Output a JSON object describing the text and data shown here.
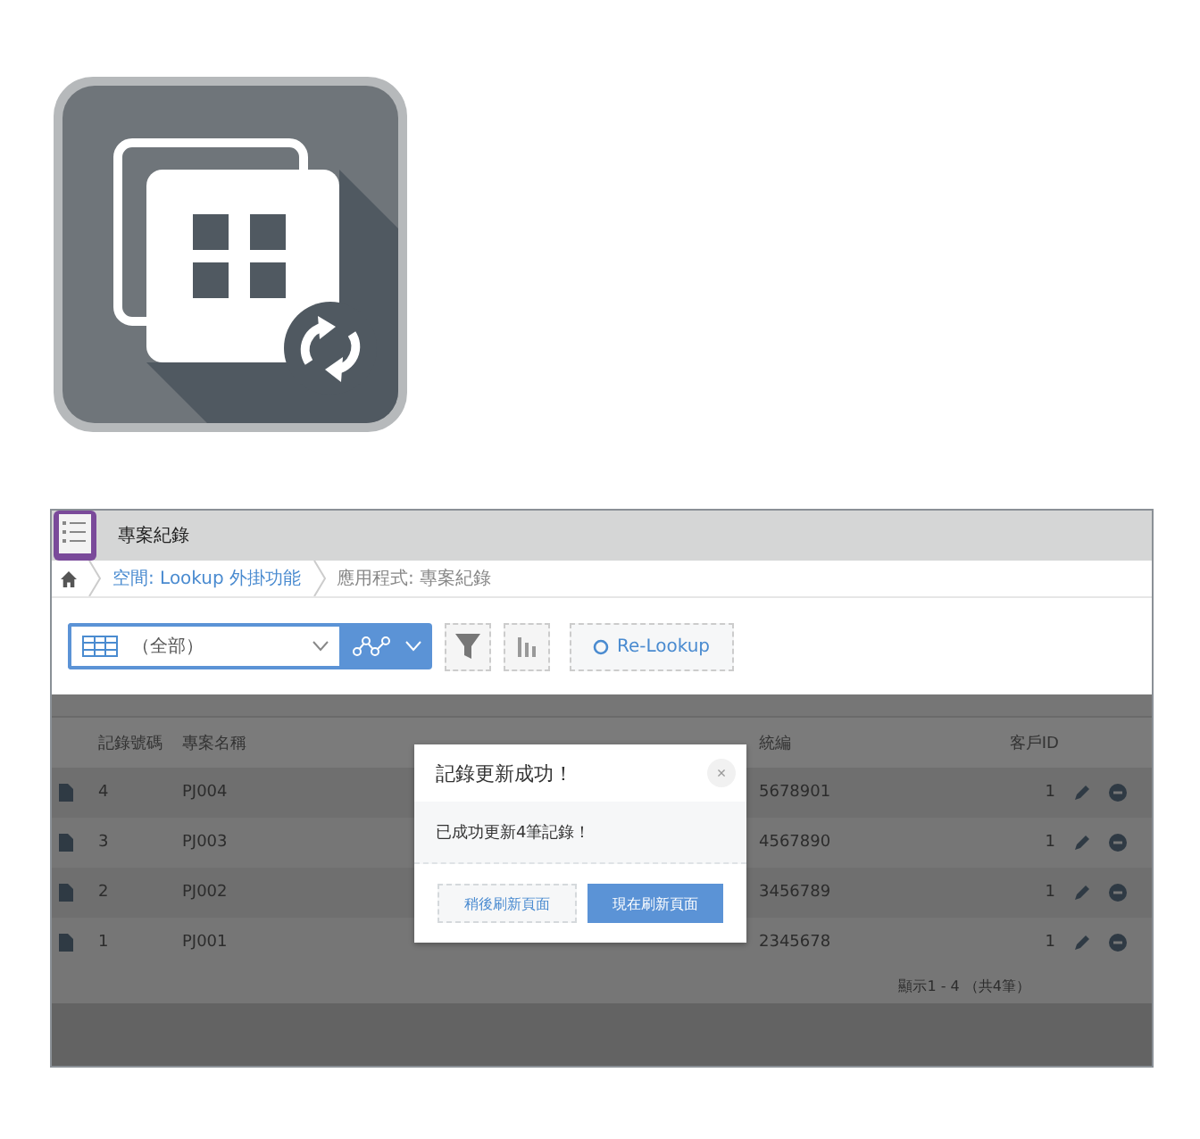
{
  "app": {
    "title": "專案紀錄"
  },
  "breadcrumbs": [
    {
      "label": "空間: Lookup 外掛功能",
      "link": true
    },
    {
      "label": "應用程式: 專案紀錄",
      "link": false
    }
  ],
  "toolbar": {
    "view": "（全部）",
    "relookup": "Re-Lookup"
  },
  "table": {
    "columns": [
      "記錄號碼",
      "專案名稱",
      "統編",
      "客戶ID"
    ],
    "rows": [
      {
        "number": "4",
        "name": "PJ004",
        "tax_id": "5678901",
        "customer_id": "1"
      },
      {
        "number": "3",
        "name": "PJ003",
        "tax_id": "4567890",
        "customer_id": "1"
      },
      {
        "number": "2",
        "name": "PJ002",
        "tax_id": "3456789",
        "customer_id": "1"
      },
      {
        "number": "1",
        "name": "PJ001",
        "tax_id": "2345678",
        "customer_id": "1"
      }
    ]
  },
  "pagination": "顯示1 - 4 （共4筆）",
  "dialog": {
    "title": "記錄更新成功！",
    "close": "×",
    "message": "已成功更新4筆記錄！",
    "buttons": [
      {
        "label": "稍後刷新頁面",
        "primary": false
      },
      {
        "label": "現在刷新頁面",
        "primary": true
      }
    ]
  }
}
